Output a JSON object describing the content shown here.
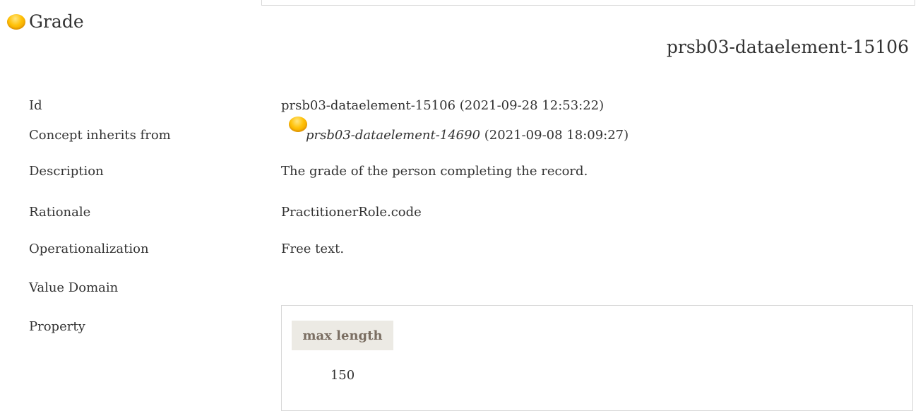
{
  "concept": {
    "title": "Grade",
    "id_heading": "prsb03-dataelement-15106"
  },
  "fields": {
    "id": {
      "label": "Id",
      "value": "prsb03-dataelement-15106 (2021-09-28 12:53:22)"
    },
    "inherits": {
      "label": "Concept inherits from",
      "ref": "prsb03-dataelement-14690",
      "date": " (2021-09-08 18:09:27)"
    },
    "description": {
      "label": "Description",
      "value": "The grade of the person completing the record."
    },
    "rationale": {
      "label": "Rationale",
      "value": "PractitionerRole.code"
    },
    "operationalization": {
      "label": "Operationalization",
      "value": "Free text."
    },
    "value_domain": {
      "label": "Value Domain"
    },
    "property": {
      "label": "Property",
      "column": "max length",
      "value": "150"
    }
  },
  "icons": {
    "status": "status-ball-icon"
  },
  "colors": {
    "status_ball": "#ffc107",
    "property_header_bg": "#eceae4",
    "property_header_text": "#7a6e62"
  }
}
